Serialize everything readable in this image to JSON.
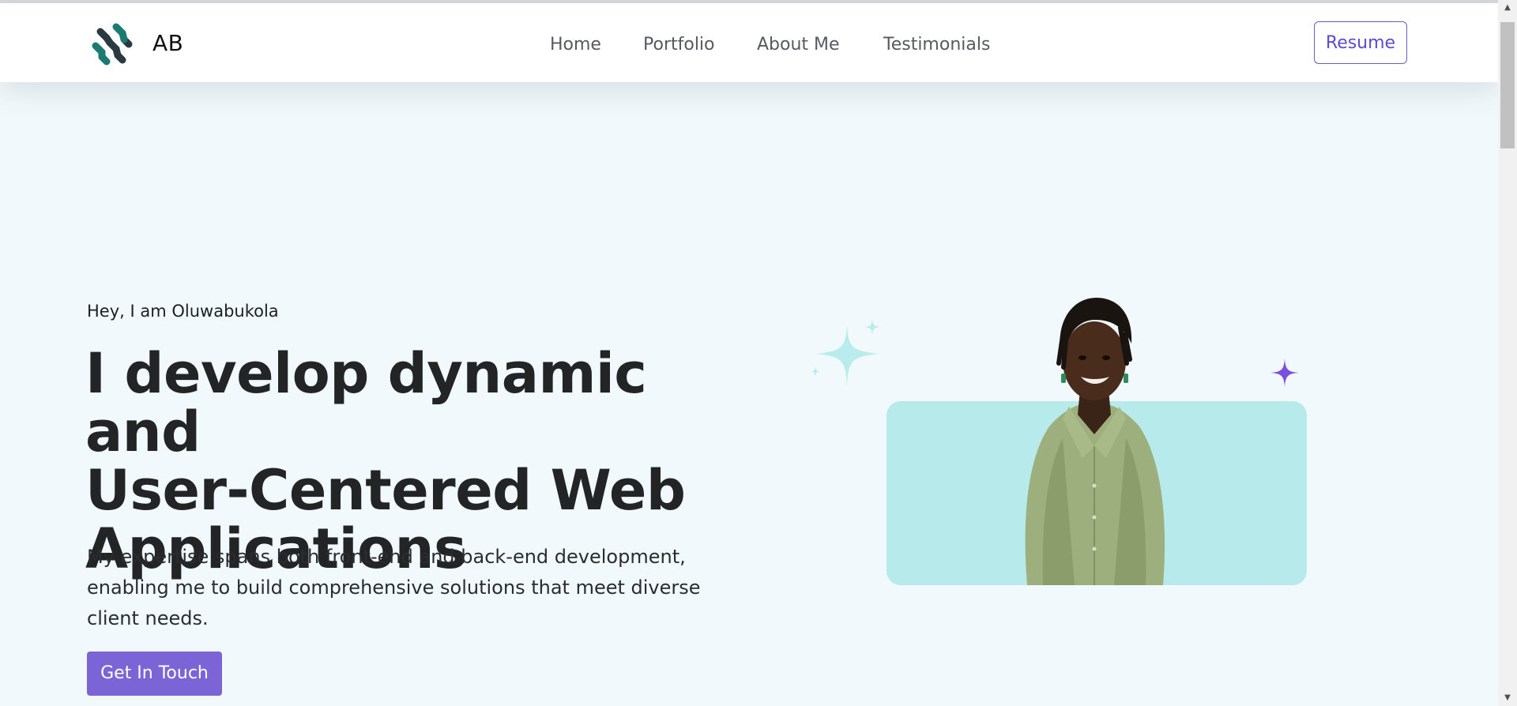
{
  "nav": {
    "brand": "AB",
    "links": [
      {
        "label": "Home"
      },
      {
        "label": "Portfolio"
      },
      {
        "label": "About Me"
      },
      {
        "label": "Testimonials"
      }
    ],
    "resume_label": "Resume"
  },
  "hero": {
    "eyebrow": "Hey, I am Oluwabukola",
    "headline_lines": [
      "I develop dynamic and",
      "User-Centered Web",
      "Applications"
    ],
    "description": "My expertise spans both front-end and back-end development, enabling me to build comprehensive solutions that meet diverse client needs.",
    "cta_label": "Get In Touch"
  },
  "colors": {
    "page_bg": "#f2f9fc",
    "accent_purple": "#7b65d6",
    "card_teal": "#b7eaea",
    "logo_teal": "#1b7a74",
    "logo_dark": "#2b3a40"
  },
  "icons": {
    "logo": "molecule-logo-icon",
    "sparkle_teal": "sparkle-icon",
    "sparkle_purple": "star-icon"
  }
}
